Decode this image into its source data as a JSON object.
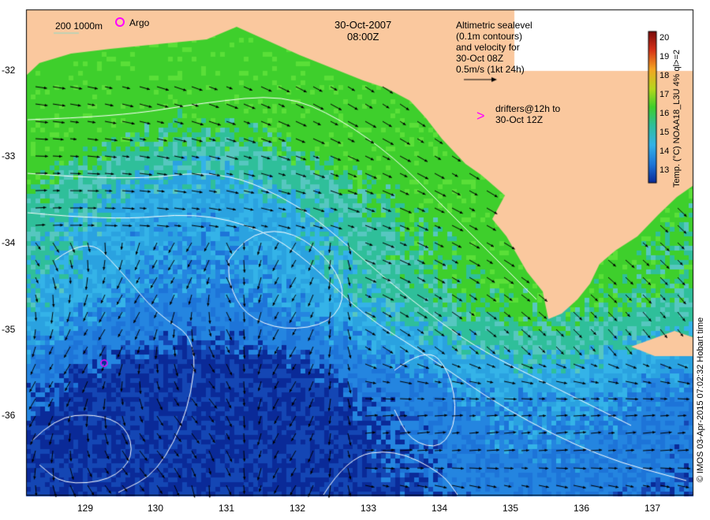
{
  "header": {
    "date": "30-Oct-2007",
    "time": "08:00Z"
  },
  "legend": {
    "isobaths": "200  1000m",
    "argo": "Argo",
    "altimetry_lines": [
      "Altimetric sealevel",
      "(0.1m contours)",
      "and velocity for",
      "30-Oct 08Z",
      "0.5m/s (1kt 24h)"
    ],
    "drifters_lines": [
      "drifters@12h to",
      "30-Oct 12Z"
    ]
  },
  "axes": {
    "y_ticks": [
      "-32",
      "-33",
      "-34",
      "-35",
      "-36"
    ],
    "x_ticks": [
      "129",
      "130",
      "131",
      "132",
      "133",
      "134",
      "135",
      "136",
      "137"
    ]
  },
  "colorbar": {
    "title": "Temp. (°C) NOAA18_L3U 4% ql>=2",
    "ticks": [
      "20",
      "19",
      "18",
      "17",
      "16",
      "15",
      "14",
      "13"
    ],
    "min": 12.5,
    "max": 20.5
  },
  "credit": "© IMOS 03-Apr-2015 07:02:32 Hobart time",
  "colors": {
    "land": "#fac89e",
    "warm_green": "#3ecf2c",
    "mid_cyan": "#34b3e8",
    "cool_blue": "#1d74d8",
    "deep_blue": "#0a2a98",
    "contour": "#ffffff",
    "drifter": "#ff00ff"
  }
}
